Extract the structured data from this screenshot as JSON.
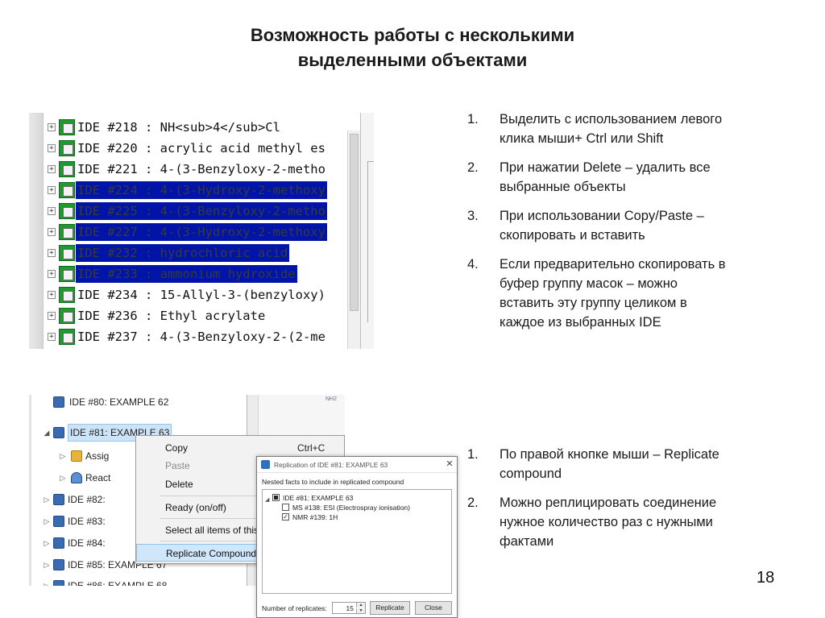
{
  "slide": {
    "title_line1": "Возможность работы с несколькими",
    "title_line2": "выделенными объектами",
    "page_number": "18"
  },
  "list_top": [
    {
      "num": "1.",
      "text": "Выделить с использованием левого клика мыши+ Ctrl или Shift"
    },
    {
      "num": "2.",
      "text": "При нажатии Delete – удалить все выбранные объекты"
    },
    {
      "num": "3.",
      "text": "При использовании Copy/Paste – скопировать и вставить"
    },
    {
      "num": "4.",
      "text": "Если предварительно скопировать в буфер группу масок – можно вставить эту группу целиком в каждое из выбранных IDE"
    }
  ],
  "list_bottom": [
    {
      "num": "1.",
      "text": "По правой кнопке мыши – Replicate compound"
    },
    {
      "num": "2.",
      "text": "Можно реплицировать соединение нужное количество раз с нужными фактами"
    }
  ],
  "tree_list": {
    "rows": [
      {
        "text": "IDE #218 : NH<sub>4</sub>Cl",
        "selected": false
      },
      {
        "text": "IDE #220 : acrylic acid methyl es",
        "selected": false
      },
      {
        "text": "IDE #221 : 4-(3-Benzyloxy-2-metho",
        "selected": false
      },
      {
        "text": "IDE #224 : 4-(3-Hydroxy-2-methoxy",
        "selected": true
      },
      {
        "text": "IDE #225 : 4-(3-Benzyloxy-2-metho",
        "selected": true
      },
      {
        "text": "IDE #227 : 4-(3-Hydroxy-2-methoxy",
        "selected": true
      },
      {
        "text": "IDE #232 : hydrochloric acid",
        "selected": true
      },
      {
        "text": "IDE #233 : ammonium hydroxide",
        "selected": true
      },
      {
        "text": "IDE #234 : 15-Allyl-3-(benzyloxy)",
        "selected": false
      },
      {
        "text": "IDE #236 : Ethyl acrylate",
        "selected": false
      },
      {
        "text": "IDE #237 : 4-(3-Benzyloxy-2-(2-me",
        "selected": false
      }
    ]
  },
  "context_tree": {
    "rows": [
      {
        "label": "IDE #80: EXAMPLE 62"
      },
      {
        "label": "IDE #81: EXAMPLE 63"
      },
      {
        "label": "Assig"
      },
      {
        "label": "React"
      },
      {
        "label": "IDE #82:"
      },
      {
        "label": "IDE #83:"
      },
      {
        "label": "IDE #84:"
      },
      {
        "label": "IDE #85: EXAMPLE 67"
      },
      {
        "label": "IDE #86: EXAMPLE 68"
      }
    ],
    "mini_label": "NH2"
  },
  "context_menu": {
    "copy": "Copy",
    "copy_shortcut": "Ctrl+C",
    "paste": "Paste",
    "delete": "Delete",
    "ready": "Ready (on/off)",
    "select_all": "Select all items of this type",
    "replicate": "Replicate Compound"
  },
  "dialog": {
    "title": "Replication of IDE #81: EXAMPLE 63",
    "close_glyph": "✕",
    "subtitle": "Nested facts to include in replicated compound",
    "tree_root": "IDE #81: EXAMPLE 63",
    "tree_child1": "MS #138: ESI (Electrospray ionisation)",
    "tree_child2": "NMR #139: 1H",
    "replicates_label": "Number of replicates:",
    "replicates_value": "15",
    "replicate_button": "Replicate",
    "close_button": "Close"
  }
}
